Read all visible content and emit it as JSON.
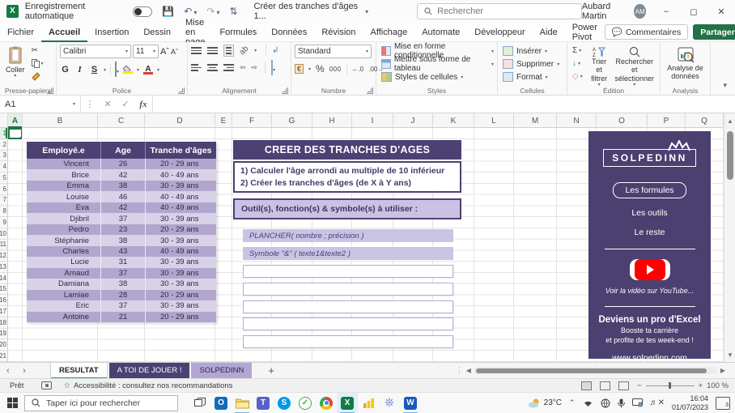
{
  "colors": {
    "excel_green": "#217346",
    "purple_dark": "#4c4173",
    "purple_mid": "#b3a6ce",
    "purple_light": "#d8d2e8",
    "purple_bar": "#cbc2e3",
    "youtube_red": "#ff0000"
  },
  "titlebar": {
    "autosave_label": "Enregistrement automatique",
    "filename": "Créer des tranches d'âges 1...",
    "search_placeholder": "Rechercher",
    "user_name": "Aubard Martin",
    "user_initials": "AM"
  },
  "ribbon": {
    "tabs": [
      {
        "label": "Fichier",
        "active": false
      },
      {
        "label": "Accueil",
        "active": true
      },
      {
        "label": "Insertion",
        "active": false
      },
      {
        "label": "Dessin",
        "active": false
      },
      {
        "label": "Mise en page",
        "active": false
      },
      {
        "label": "Formules",
        "active": false
      },
      {
        "label": "Données",
        "active": false
      },
      {
        "label": "Révision",
        "active": false
      },
      {
        "label": "Affichage",
        "active": false
      },
      {
        "label": "Automate",
        "active": false
      },
      {
        "label": "Développeur",
        "active": false
      },
      {
        "label": "Aide",
        "active": false
      },
      {
        "label": "Power Pivot",
        "active": false
      }
    ],
    "comments_label": "Commentaires",
    "share_label": "Partager",
    "paste_label": "Coller",
    "font_name": "Calibri",
    "font_size": "11",
    "bold_label": "G",
    "italic_label": "I",
    "underline_label": "S",
    "number_format": "Standard",
    "styles_items": [
      "Mise en forme conditionnelle",
      "Mettre sous forme de tableau",
      "Styles de cellules"
    ],
    "cells_items": [
      "Insérer",
      "Supprimer",
      "Format"
    ],
    "sort_label": "Trier et filtrer",
    "find_label": "Rechercher et sélectionner",
    "analysis_label": "Analyse de données",
    "groups": [
      "Presse-papiers",
      "Police",
      "Alignement",
      "Nombre",
      "Styles",
      "Cellules",
      "Édition",
      "Analysis"
    ]
  },
  "formula_bar": {
    "name_box": "A1",
    "fx_label": "fx"
  },
  "grid": {
    "columns": [
      "A",
      "B",
      "C",
      "D",
      "E",
      "F",
      "G",
      "H",
      "I",
      "J",
      "K",
      "L",
      "M",
      "N",
      "O",
      "P",
      "Q"
    ],
    "rows": [
      "1",
      "2",
      "3",
      "4",
      "5",
      "6",
      "7",
      "8",
      "9",
      "10",
      "11",
      "12",
      "13",
      "14",
      "15",
      "16",
      "17",
      "18",
      "19",
      "20",
      "21"
    ],
    "selected_cell": "A1"
  },
  "table": {
    "headers": [
      "Employé.e",
      "Age",
      "Tranche d'âges"
    ],
    "rows": [
      [
        "Vincent",
        "26",
        "20 - 29 ans"
      ],
      [
        "Brice",
        "42",
        "40 - 49 ans"
      ],
      [
        "Emma",
        "38",
        "30 - 39 ans"
      ],
      [
        "Louise",
        "46",
        "40 - 49 ans"
      ],
      [
        "Eva",
        "42",
        "40 - 49 ans"
      ],
      [
        "Djibril",
        "37",
        "30 - 39 ans"
      ],
      [
        "Pedro",
        "23",
        "20 - 29 ans"
      ],
      [
        "Stéphanie",
        "38",
        "30 - 39 ans"
      ],
      [
        "Charles",
        "43",
        "40 - 49 ans"
      ],
      [
        "Lucie",
        "31",
        "30 - 39 ans"
      ],
      [
        "Arnaud",
        "37",
        "30 - 39 ans"
      ],
      [
        "Damiana",
        "38",
        "30 - 39 ans"
      ],
      [
        "Lamiae",
        "28",
        "20 - 29 ans"
      ],
      [
        "Eric",
        "37",
        "30 - 39 ans"
      ],
      [
        "Antoine",
        "21",
        "20 - 29 ans"
      ]
    ]
  },
  "content": {
    "title": "CREER DES TRANCHES D'AGES",
    "instruction1": "1) Calculer l'âge arrondi au multiple de 10 inférieur",
    "instruction2": "2) Créer les tranches d'âges (de X à Y ans)",
    "tools_header": "Outil(s), fonction(s) & symbole(s) à utiliser :",
    "hint1": "PLANCHER( nombre ; précision )",
    "hint2": "Symbole \"&\" ( texte1&texte2 )",
    "empty_box_count": 5
  },
  "sidebar": {
    "brand": "SOLPEDINN",
    "nav_formules": "Les formules",
    "nav_outils": "Les outils",
    "nav_reste": "Le reste",
    "video_caption": "Voir la vidéo sur YouTube...",
    "promo_title": "Deviens un pro d'Excel",
    "promo_line1": "Booste ta carrière",
    "promo_line2": "et profite de tes week-end !",
    "website": "www.solpedinn.com"
  },
  "sheet_tabs": [
    {
      "label": "RESULTAT",
      "style": "active"
    },
    {
      "label": "A TOI DE JOUER !",
      "style": "dark"
    },
    {
      "label": "SOLPEDINN",
      "style": "light"
    }
  ],
  "status_bar": {
    "ready_label": "Prêt",
    "accessibility_label": "Accessibilité : consultez nos recommandations",
    "zoom_level": "100 %"
  },
  "taskbar": {
    "search_placeholder": "Taper ici pour rechercher",
    "temperature": "23°C",
    "time": "16:04",
    "date": "01/07/2023",
    "notification_count": "3"
  }
}
